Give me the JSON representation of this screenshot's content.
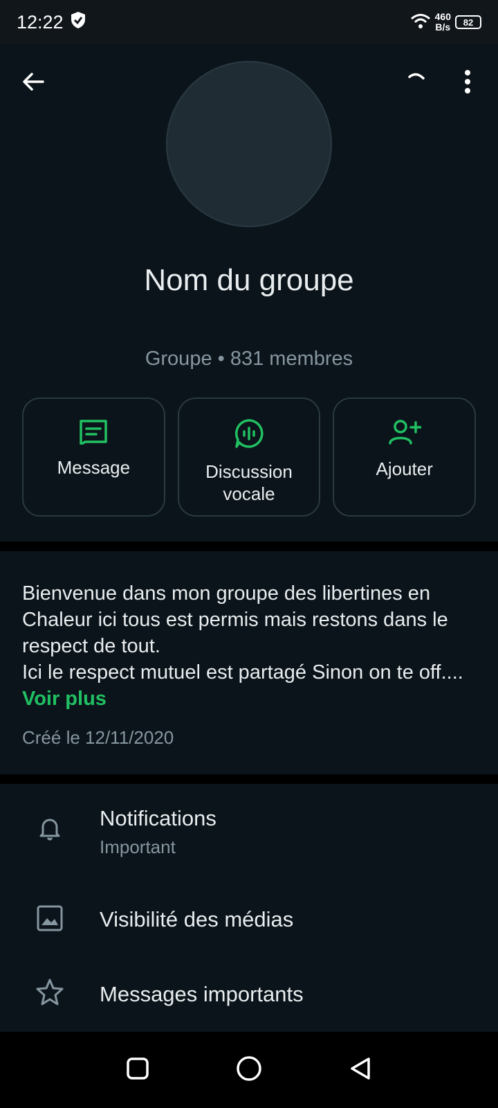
{
  "status_bar": {
    "time": "12:22",
    "net_speed_top": "460",
    "net_speed_bottom": "B/s",
    "battery": "82"
  },
  "group": {
    "name": "Nom du groupe",
    "subtitle": "Groupe • 831 membres"
  },
  "actions": [
    {
      "label": "Message",
      "icon": "message-icon"
    },
    {
      "label": "Discussion vocale",
      "icon": "voice-chat-icon"
    },
    {
      "label": "Ajouter",
      "icon": "add-person-icon"
    }
  ],
  "description": {
    "text": "Bienvenue dans mon groupe des libertines en Chaleur ici tous est permis mais restons dans le respect de tout.\nIci le respect mutuel est partagé Sinon on te off....",
    "more_label": "Voir plus",
    "created": "Créé le 12/11/2020"
  },
  "settings": [
    {
      "title": "Notifications",
      "subtitle": "Important",
      "icon": "bell-icon"
    },
    {
      "title": "Visibilité des médias",
      "icon": "image-icon"
    },
    {
      "title": "Messages importants",
      "icon": "star-icon"
    }
  ],
  "colors": {
    "accent": "#21c063",
    "background": "#0b141a",
    "secondary_text": "#8696a0"
  }
}
